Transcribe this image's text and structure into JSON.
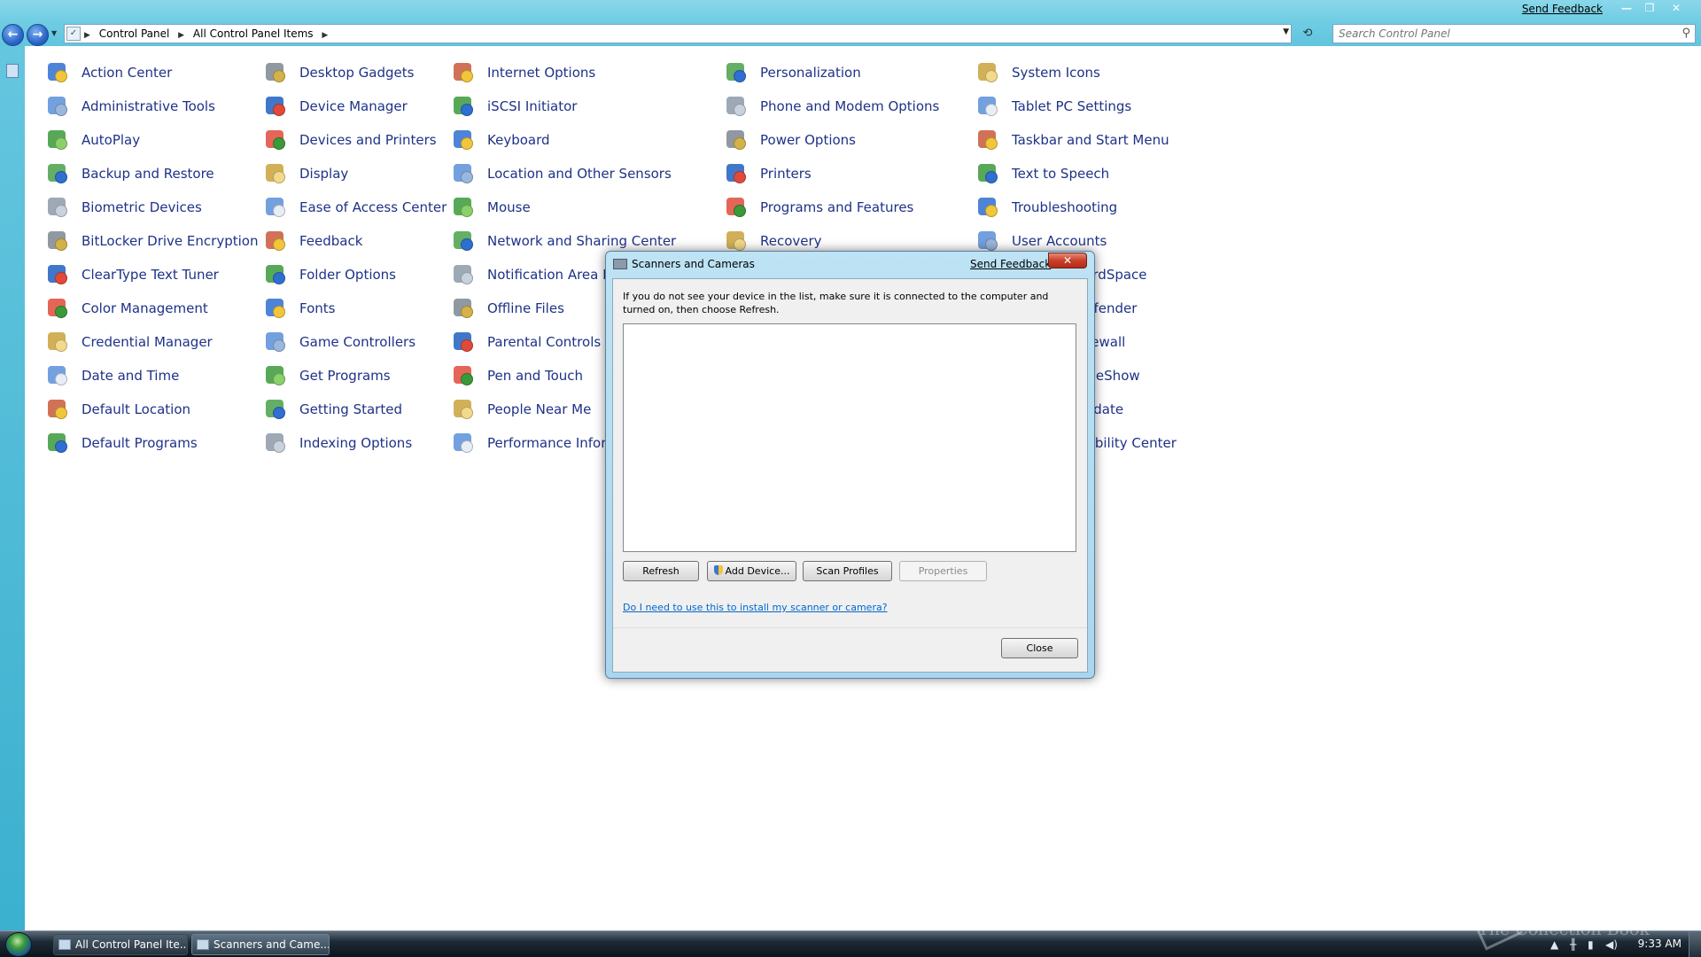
{
  "window": {
    "send_feedback": "Send Feedback",
    "caption_minimize": "—",
    "caption_restore": "❐",
    "caption_close": "✕"
  },
  "address": {
    "back_glyph": "←",
    "forward_glyph": "→",
    "recent_glyph": "▼",
    "crumbs": [
      "Control Panel",
      "All Control Panel Items"
    ],
    "crumb_sep": "▶",
    "dropdown_glyph": "▼",
    "refresh_glyph": "⟲"
  },
  "search": {
    "placeholder": "Search Control Panel",
    "icon_glyph": "⚲"
  },
  "items": [
    [
      "Action Center",
      "Administrative Tools",
      "AutoPlay",
      "Backup and Restore",
      "Biometric Devices",
      "BitLocker Drive Encryption",
      "ClearType Text Tuner",
      "Color Management",
      "Credential Manager",
      "Date and Time",
      "Default Location",
      "Default Programs"
    ],
    [
      "Desktop Gadgets",
      "Device Manager",
      "Devices and Printers",
      "Display",
      "Ease of Access Center",
      "Feedback",
      "Folder Options",
      "Fonts",
      "Game Controllers",
      "Get Programs",
      "Getting Started",
      "Indexing Options"
    ],
    [
      "Internet Options",
      "iSCSI Initiator",
      "Keyboard",
      "Location and Other Sensors",
      "Mouse",
      "Network and Sharing Center",
      "Notification Area Icons",
      "Offline Files",
      "Parental Controls",
      "Pen and Touch",
      "People Near Me",
      "Performance Information and Tools"
    ],
    [
      "Personalization",
      "Phone and Modem Options",
      "Power Options",
      "Printers",
      "Programs and Features",
      "Recovery"
    ],
    [
      "System Icons",
      "Tablet PC Settings",
      "Taskbar and Start Menu",
      "Text to Speech",
      "Troubleshooting",
      "User Accounts",
      "Windows CardSpace",
      "Windows Defender",
      "Windows Firewall",
      "Windows SideShow",
      "Windows Update",
      "Windows Mobility Center"
    ]
  ],
  "dialog": {
    "title": "Scanners and Cameras",
    "send_feedback": "Send Feedback",
    "close_glyph": "✕",
    "message": "If you do not see your device in the list, make sure it is connected to the computer and turned on, then choose Refresh.",
    "buttons": {
      "refresh": "Refresh",
      "add_device": "Add Device...",
      "scan_profiles": "Scan Profiles",
      "properties": "Properties",
      "close": "Close"
    },
    "help_link": "Do I need to use this to install my scanner or camera?"
  },
  "taskbar": {
    "tasks": [
      "All Control Panel Ite...",
      "Scanners and Came..."
    ],
    "clock": "9:33 AM",
    "watermark": "The Collection Book"
  },
  "colors": {
    "link": "#1e3287",
    "accent": "#6fcde3",
    "dialog_close": "#c9402a"
  }
}
